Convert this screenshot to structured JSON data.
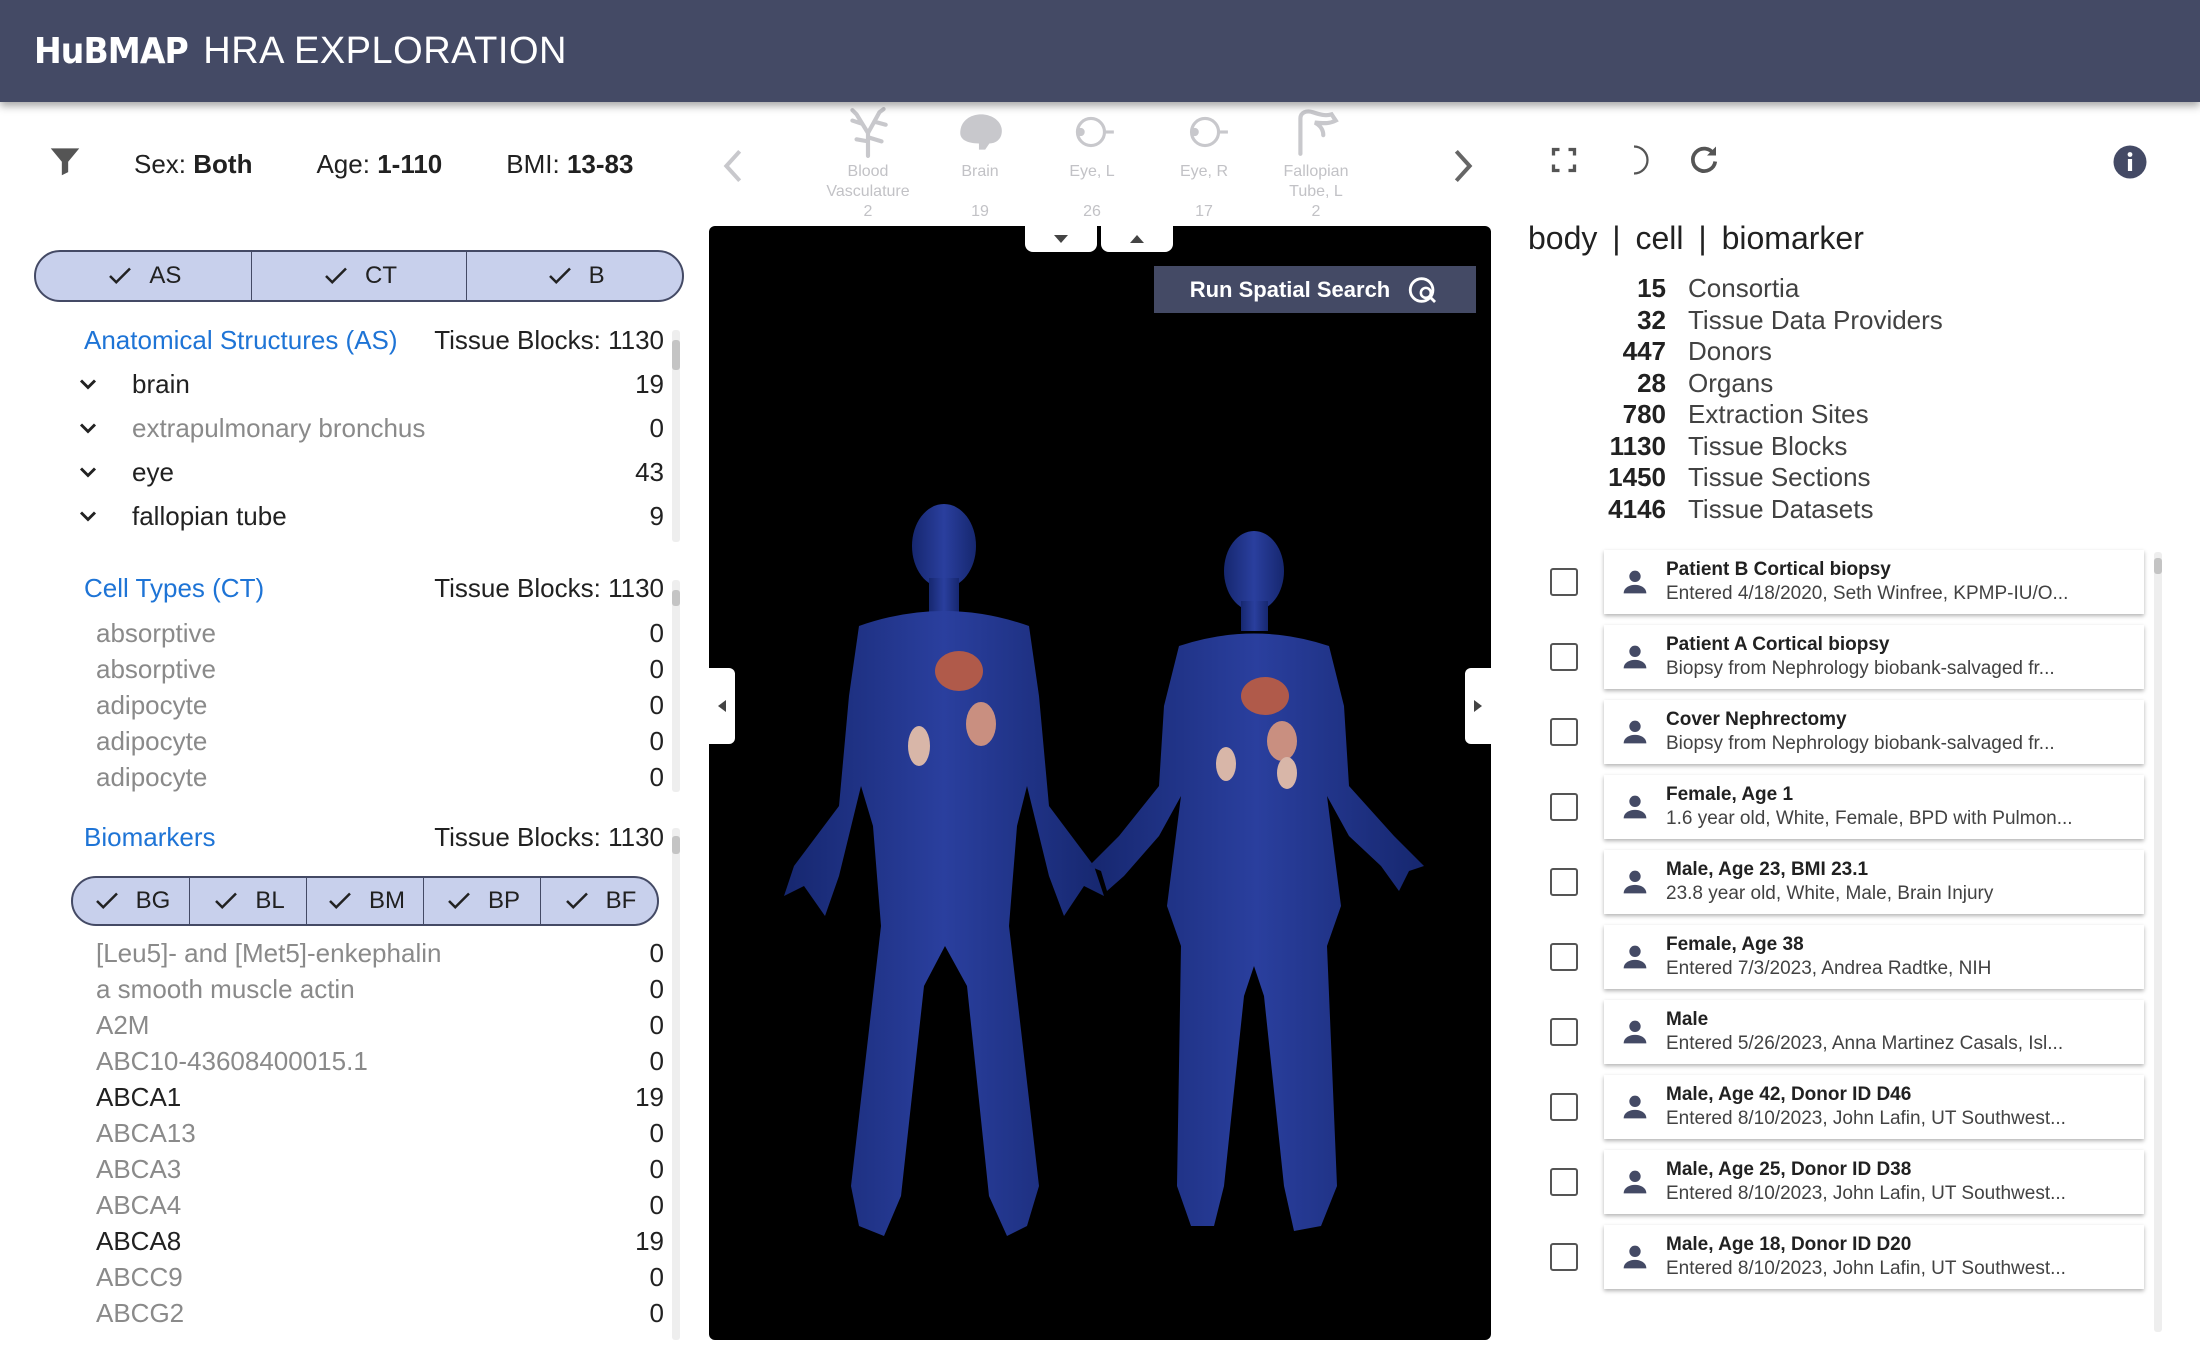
{
  "header": {
    "logo": "HuBMAP",
    "title": "HRA EXPLORATION"
  },
  "filters": {
    "sex_label": "Sex:",
    "sex_value": "Both",
    "age_label": "Age:",
    "age_value": "1-110",
    "bmi_label": "BMI:",
    "bmi_value": "13-83"
  },
  "organs": [
    {
      "name_line1": "Blood",
      "name_line2": "Vasculature",
      "count": "2",
      "icon": "blood-vasculature-icon"
    },
    {
      "name_line1": "Brain",
      "name_line2": "",
      "count": "19",
      "icon": "brain-icon"
    },
    {
      "name_line1": "Eye, L",
      "name_line2": "",
      "count": "26",
      "icon": "eye-left-icon"
    },
    {
      "name_line1": "Eye, R",
      "name_line2": "",
      "count": "17",
      "icon": "eye-right-icon"
    },
    {
      "name_line1": "Fallopian",
      "name_line2": "Tube, L",
      "count": "2",
      "icon": "fallopian-tube-icon"
    }
  ],
  "toggles": {
    "as": "AS",
    "ct": "CT",
    "b": "B"
  },
  "anatomical": {
    "title": "Anatomical Structures (AS)",
    "tissue_blocks": "Tissue Blocks: 1130",
    "items": [
      {
        "label": "brain",
        "count": "19"
      },
      {
        "label": "extrapulmonary bronchus",
        "count": "0"
      },
      {
        "label": "eye",
        "count": "43"
      },
      {
        "label": "fallopian tube",
        "count": "9"
      }
    ]
  },
  "cell_types": {
    "title": "Cell Types (CT)",
    "tissue_blocks": "Tissue Blocks: 1130",
    "items": [
      {
        "label": "absorptive",
        "count": "0"
      },
      {
        "label": "absorptive",
        "count": "0"
      },
      {
        "label": "adipocyte",
        "count": "0"
      },
      {
        "label": "adipocyte",
        "count": "0"
      },
      {
        "label": "adipocyte",
        "count": "0"
      }
    ]
  },
  "biomarkers": {
    "title": "Biomarkers",
    "tissue_blocks": "Tissue Blocks: 1130",
    "toggles": [
      "BG",
      "BL",
      "BM",
      "BP",
      "BF"
    ],
    "items": [
      {
        "label": "[Leu5]- and [Met5]-enkephalin",
        "count": "0"
      },
      {
        "label": "a smooth muscle actin",
        "count": "0"
      },
      {
        "label": "A2M",
        "count": "0"
      },
      {
        "label": "ABC10-43608400015.1",
        "count": "0"
      },
      {
        "label": "ABCA1",
        "count": "19"
      },
      {
        "label": "ABCA13",
        "count": "0"
      },
      {
        "label": "ABCA3",
        "count": "0"
      },
      {
        "label": "ABCA4",
        "count": "0"
      },
      {
        "label": "ABCA8",
        "count": "19"
      },
      {
        "label": "ABCC9",
        "count": "0"
      },
      {
        "label": "ABCG2",
        "count": "0"
      }
    ]
  },
  "viewer": {
    "spatial_search_label": "Run Spatial Search"
  },
  "summary": {
    "tab_body": "body",
    "tab_cell": "cell",
    "tab_biomarker": "biomarker",
    "stats": [
      {
        "value": "15",
        "label": "Consortia"
      },
      {
        "value": "32",
        "label": "Tissue Data Providers"
      },
      {
        "value": "447",
        "label": "Donors"
      },
      {
        "value": "28",
        "label": "Organs"
      },
      {
        "value": "780",
        "label": "Extraction Sites"
      },
      {
        "value": "1130",
        "label": "Tissue Blocks"
      },
      {
        "value": "1450",
        "label": "Tissue Sections"
      },
      {
        "value": "4146",
        "label": "Tissue Datasets"
      }
    ]
  },
  "results": [
    {
      "title": "Patient B Cortical biopsy",
      "desc": "Entered 4/18/2020, Seth Winfree, KPMP-IU/O..."
    },
    {
      "title": "Patient A Cortical biopsy",
      "desc": "Biopsy from Nephrology biobank-salvaged fr..."
    },
    {
      "title": "Cover Nephrectomy",
      "desc": "Biopsy from Nephrology biobank-salvaged fr..."
    },
    {
      "title": "Female, Age 1",
      "desc": "1.6 year old, White, Female, BPD with Pulmon..."
    },
    {
      "title": "Male, Age 23, BMI 23.1",
      "desc": "23.8 year old, White, Male, Brain Injury"
    },
    {
      "title": "Female, Age 38",
      "desc": "Entered 7/3/2023, Andrea Radtke, NIH"
    },
    {
      "title": "Male",
      "desc": "Entered 5/26/2023, Anna Martinez Casals, Isl..."
    },
    {
      "title": "Male, Age 42, Donor ID D46",
      "desc": "Entered 8/10/2023, John Lafin, UT Southwest..."
    },
    {
      "title": "Male, Age 25, Donor ID D38",
      "desc": "Entered 8/10/2023, John Lafin, UT Southwest..."
    },
    {
      "title": "Male, Age 18, Donor ID D20",
      "desc": "Entered 8/10/2023, John Lafin, UT Southwest..."
    }
  ],
  "colors": {
    "header": "#444a65",
    "accent_link": "#1e74d6",
    "body_blue": "#1c2f8a",
    "toggle_bg": "#c8d0ec"
  }
}
